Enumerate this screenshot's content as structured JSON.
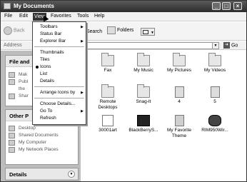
{
  "window": {
    "title": "My Documents"
  },
  "menu": {
    "items": [
      "File",
      "Edit",
      "View",
      "Favorites",
      "Tools",
      "Help"
    ]
  },
  "toolbar": {
    "back_label": "Back",
    "search_label": "Search",
    "folders_label": "Folders"
  },
  "address": {
    "label": "Address",
    "go_label": "Go"
  },
  "view_menu": {
    "items": [
      "Toolbars",
      "Status Bar",
      "Explorer Bar",
      "Thumbnails",
      "Tiles",
      "Icons",
      "List",
      "Details",
      "Arrange Icons by",
      "Choose Details...",
      "Go To",
      "Refresh"
    ],
    "selected": "Icons"
  },
  "left_panel": {
    "file_and_folder": {
      "title": "File and",
      "items": [
        "Mak",
        "Publ",
        "the",
        "Shar"
      ]
    },
    "other_places": {
      "title": "Other P",
      "items": [
        "Desktop",
        "Shared Documents",
        "My Computer",
        "My Network Places"
      ]
    },
    "details": {
      "title": "Details"
    }
  },
  "files": [
    {
      "name": "Fax",
      "icon": "folder-icon"
    },
    {
      "name": "My Music",
      "icon": "folder-icon"
    },
    {
      "name": "My Pictures",
      "icon": "folder-icon"
    },
    {
      "name": "My Videos",
      "icon": "folder-icon"
    },
    {
      "name": "Remote Desktops",
      "icon": "folder-icon"
    },
    {
      "name": "Snag-It",
      "icon": "folder-icon"
    },
    {
      "name": "4",
      "icon": "document-icon"
    },
    {
      "name": "5",
      "icon": "document-icon"
    },
    {
      "name": "30001art",
      "icon": "image-icon"
    },
    {
      "name": "BlackBerryS...",
      "icon": "blackberry-icon"
    },
    {
      "name": "My Favorite Theme",
      "icon": "theme-icon"
    },
    {
      "name": "RIM950Wir...",
      "icon": "device-icon"
    }
  ]
}
